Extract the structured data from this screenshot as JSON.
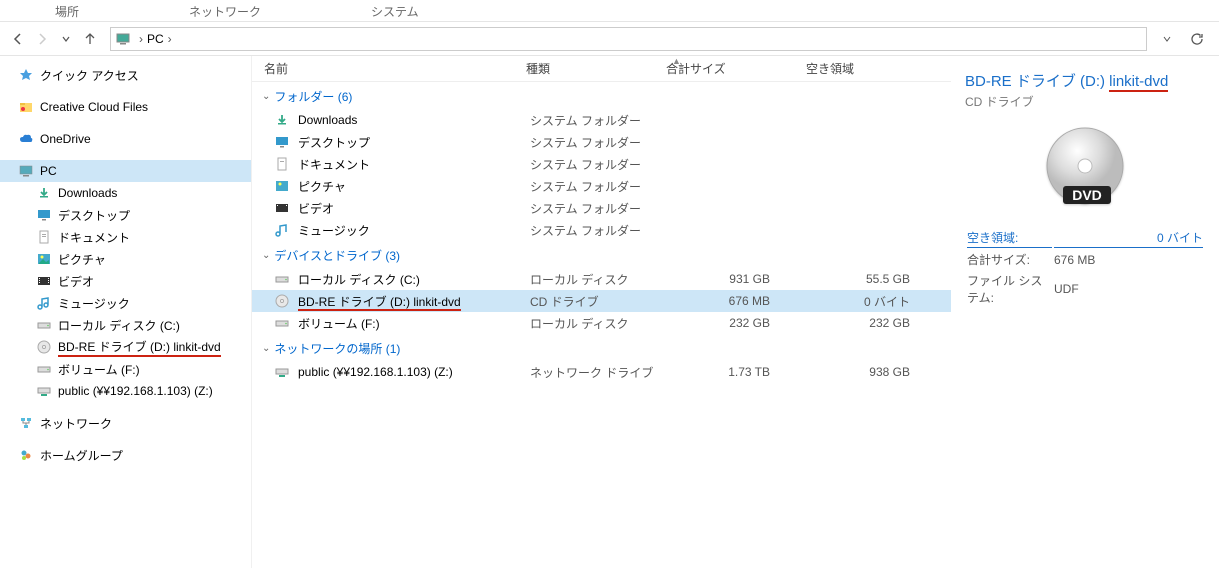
{
  "ribbon": {
    "tabs": [
      "場所",
      "ネットワーク",
      "システム"
    ]
  },
  "breadcrumb": {
    "root": "PC"
  },
  "sidebar": {
    "quick": "クイック アクセス",
    "ccfiles": "Creative Cloud Files",
    "onedrive": "OneDrive",
    "pc": "PC",
    "children": {
      "downloads": "Downloads",
      "desktop": "デスクトップ",
      "documents": "ドキュメント",
      "pictures": "ピクチャ",
      "videos": "ビデオ",
      "music": "ミュージック",
      "localC": "ローカル ディスク (C:)",
      "bdre": "BD-RE ドライブ (D:) linkit-dvd",
      "volF": "ボリューム (F:)",
      "publicZ": "public (¥¥192.168.1.103) (Z:)"
    },
    "network": "ネットワーク",
    "homegroup": "ホームグループ"
  },
  "columns": {
    "name": "名前",
    "type": "種類",
    "total": "合計サイズ",
    "free": "空き領域"
  },
  "groups": {
    "folders": "フォルダー (6)",
    "devices": "デバイスとドライブ (3)",
    "netloc": "ネットワークの場所 (1)"
  },
  "folderRows": [
    {
      "name": "Downloads",
      "type": "システム フォルダー"
    },
    {
      "name": "デスクトップ",
      "type": "システム フォルダー"
    },
    {
      "name": "ドキュメント",
      "type": "システム フォルダー"
    },
    {
      "name": "ピクチャ",
      "type": "システム フォルダー"
    },
    {
      "name": "ビデオ",
      "type": "システム フォルダー"
    },
    {
      "name": "ミュージック",
      "type": "システム フォルダー"
    }
  ],
  "driveRows": [
    {
      "name": "ローカル ディスク (C:)",
      "type": "ローカル ディスク",
      "size": "931 GB",
      "free": "55.5 GB"
    },
    {
      "name": "BD-RE ドライブ (D:) linkit-dvd",
      "type": "CD ドライブ",
      "size": "676 MB",
      "free": "0 バイト",
      "selected": true
    },
    {
      "name": "ボリューム (F:)",
      "type": "ローカル ディスク",
      "size": "232 GB",
      "free": "232 GB"
    }
  ],
  "netRows": [
    {
      "name": "public (¥¥192.168.1.103) (Z:)",
      "type": "ネットワーク ドライブ",
      "size": "1.73 TB",
      "free": "938 GB"
    }
  ],
  "details": {
    "title_pre": "BD-RE ドライブ (D:) ",
    "title_vol": "linkit-dvd",
    "subtitle": "CD ドライブ",
    "thumb_label": "DVD",
    "free_label": "空き領域:",
    "free_val": "0 バイト",
    "total_label": "合計サイズ:",
    "total_val": "676 MB",
    "fs_label": "ファイル システム:",
    "fs_val": "UDF"
  }
}
